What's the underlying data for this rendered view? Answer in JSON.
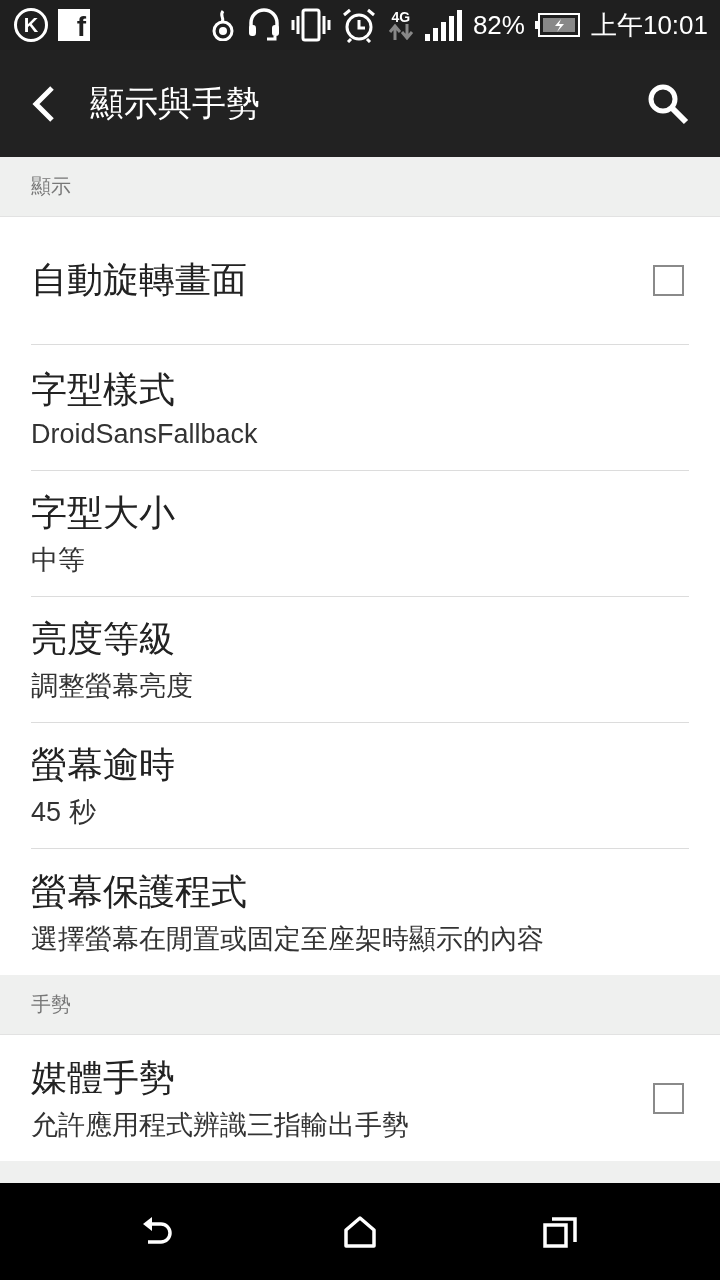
{
  "status_bar": {
    "notification_icons": [
      {
        "glyph": "K"
      },
      {
        "glyph": "f"
      }
    ],
    "network": "4G",
    "battery": "82%",
    "time": "上午10:01"
  },
  "app_bar": {
    "title": "顯示與手勢"
  },
  "sections": [
    {
      "header": "顯示",
      "items": [
        {
          "kind": "checkbox",
          "title": "自動旋轉畫面",
          "checked": false
        },
        {
          "kind": "text",
          "title": "字型樣式",
          "summary": "DroidSansFallback"
        },
        {
          "kind": "text",
          "title": "字型大小",
          "summary": "中等"
        },
        {
          "kind": "text",
          "title": "亮度等級",
          "summary": "調整螢幕亮度"
        },
        {
          "kind": "text",
          "title": "螢幕逾時",
          "summary": "45 秒"
        },
        {
          "kind": "text",
          "title": "螢幕保護程式",
          "summary": "選擇螢幕在閒置或固定至座架時顯示的內容"
        }
      ]
    },
    {
      "header": "手勢",
      "items": [
        {
          "kind": "checkbox",
          "title": "媒體手勢",
          "summary": "允許應用程式辨識三指輸出手勢",
          "checked": false
        }
      ]
    }
  ]
}
